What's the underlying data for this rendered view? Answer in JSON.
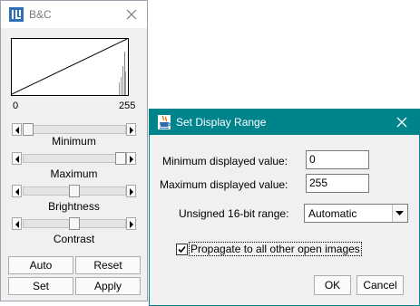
{
  "bc_window": {
    "title": "B&C",
    "range_min": "0",
    "range_max": "255",
    "sliders": [
      {
        "label": "Minimum",
        "position": 0.0
      },
      {
        "label": "Maximum",
        "position": 1.0
      },
      {
        "label": "Brightness",
        "position": 0.5
      },
      {
        "label": "Contrast",
        "position": 0.5
      }
    ],
    "buttons": {
      "auto": "Auto",
      "reset": "Reset",
      "set": "Set",
      "apply": "Apply"
    },
    "icon": "imagej-icon"
  },
  "dialog": {
    "title": "Set Display Range",
    "icon": "java-cup-icon",
    "accent_color": "#00848c",
    "min_label": "Minimum displayed value:",
    "min_value": "0",
    "max_label": "Maximum displayed value:",
    "max_value": "255",
    "unsigned_label": "Unsigned 16-bit range:",
    "unsigned_value": "Automatic",
    "propagate_label": "Propagate to all other open images",
    "propagate_checked": true,
    "ok_label": "OK",
    "cancel_label": "Cancel"
  }
}
